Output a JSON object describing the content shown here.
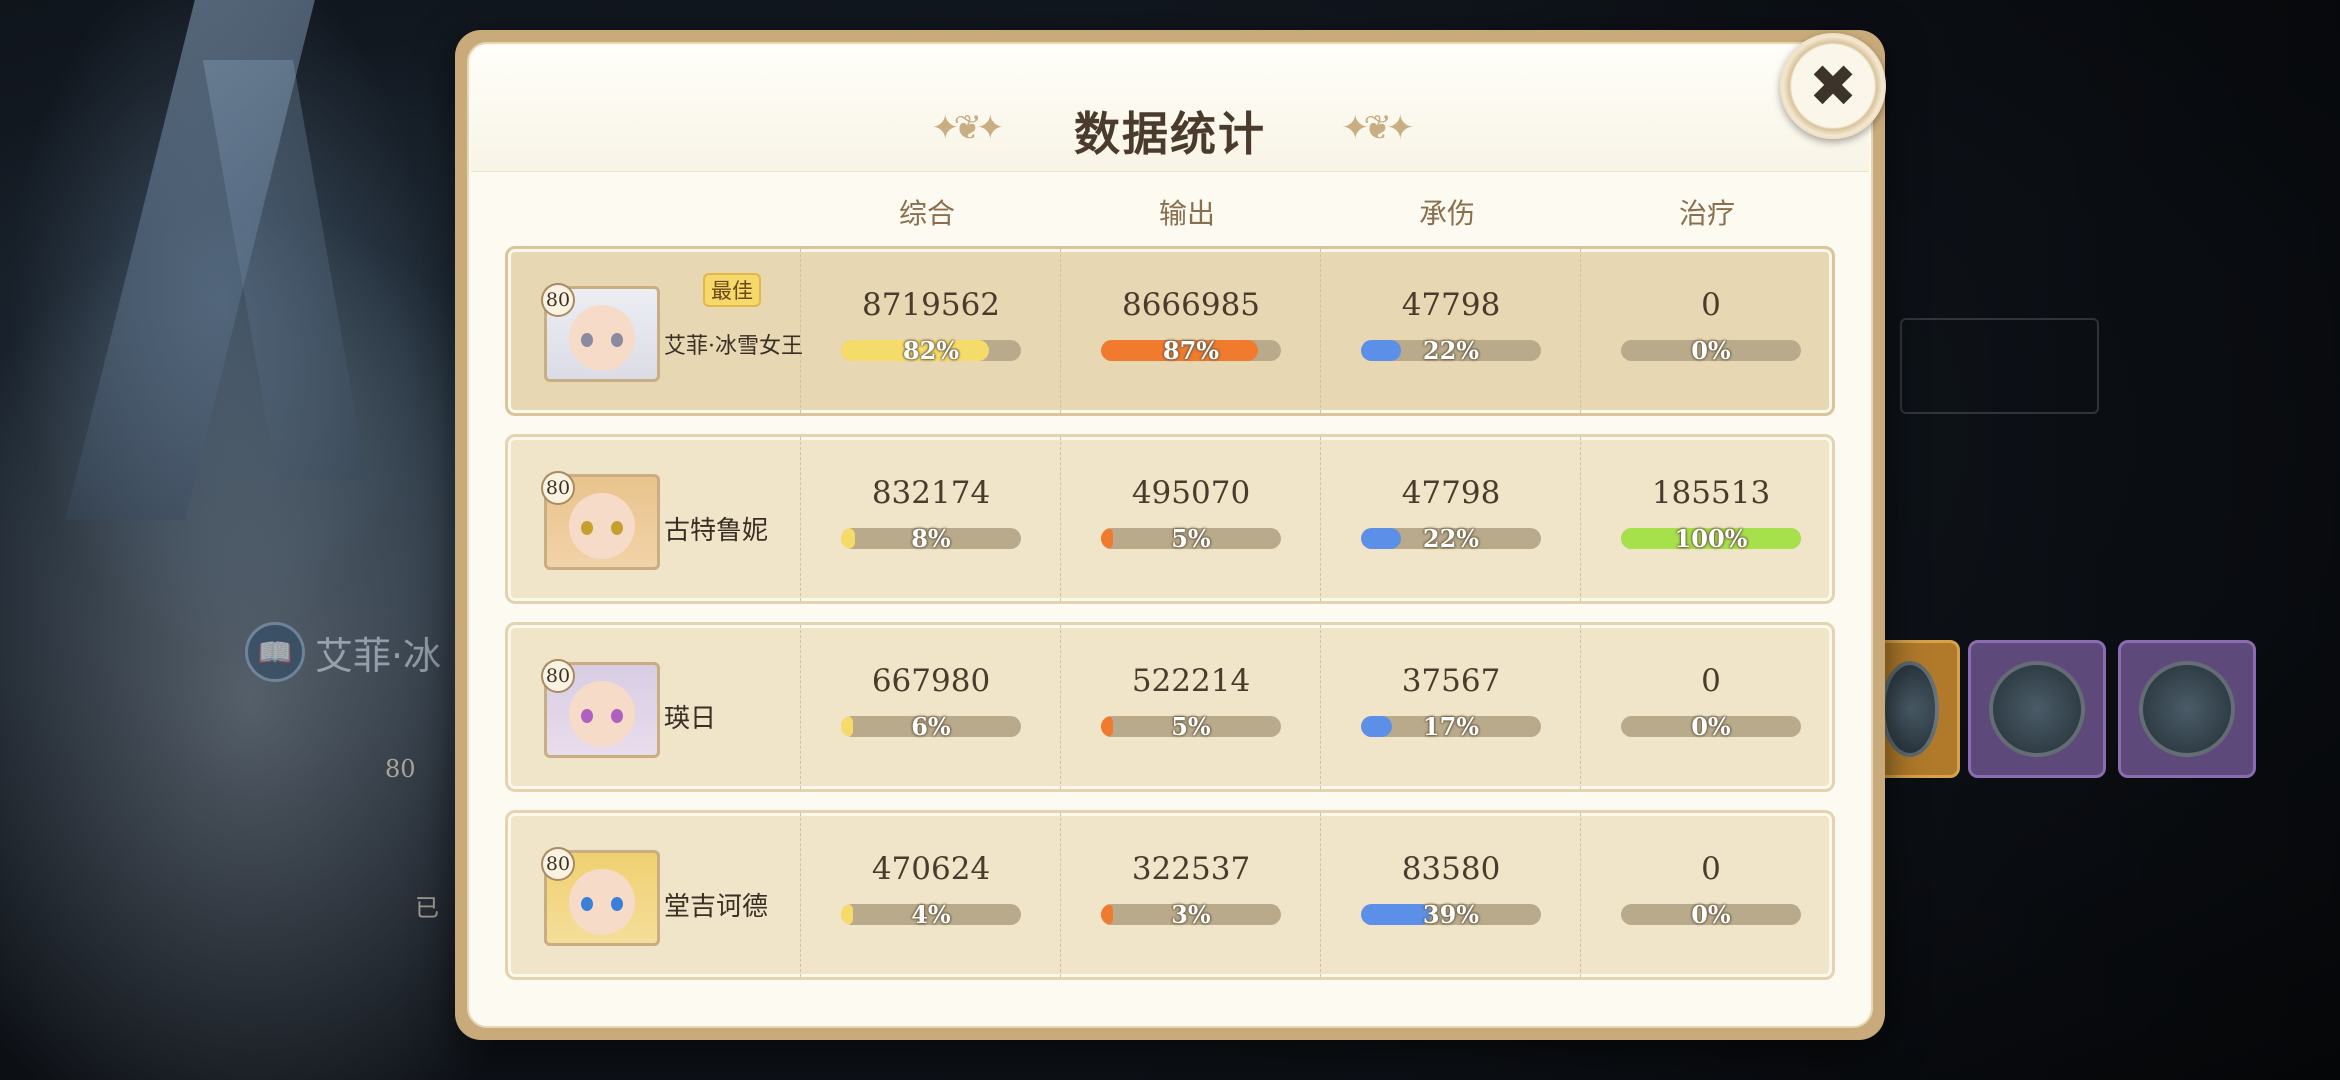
{
  "panel": {
    "title": "数据统计",
    "flourish_left": "✦❦✦",
    "flourish_right": "✦❦✦",
    "close_icon": "✖"
  },
  "columns": [
    "综合",
    "输出",
    "承伤",
    "治疗"
  ],
  "colors": {
    "overall": "#f5dc6a",
    "damage": "#f07a2e",
    "tank": "#5b8fe8",
    "heal": "#a6e04a"
  },
  "heroes": [
    {
      "level": "80",
      "name": "艾菲·冰雪女王",
      "badge": "最佳",
      "stats": [
        {
          "value": "8719562",
          "percent": "82%",
          "fraction": 0.82
        },
        {
          "value": "8666985",
          "percent": "87%",
          "fraction": 0.87
        },
        {
          "value": "47798",
          "percent": "22%",
          "fraction": 0.22
        },
        {
          "value": "0",
          "percent": "0%",
          "fraction": 0
        }
      ]
    },
    {
      "level": "80",
      "name": "古特鲁妮",
      "badge": "",
      "stats": [
        {
          "value": "832174",
          "percent": "8%",
          "fraction": 0.08
        },
        {
          "value": "495070",
          "percent": "5%",
          "fraction": 0.05
        },
        {
          "value": "47798",
          "percent": "22%",
          "fraction": 0.22
        },
        {
          "value": "185513",
          "percent": "100%",
          "fraction": 1.0
        }
      ]
    },
    {
      "level": "80",
      "name": "瑛日",
      "badge": "",
      "stats": [
        {
          "value": "667980",
          "percent": "6%",
          "fraction": 0.06
        },
        {
          "value": "522214",
          "percent": "5%",
          "fraction": 0.05
        },
        {
          "value": "37567",
          "percent": "17%",
          "fraction": 0.17
        },
        {
          "value": "0",
          "percent": "0%",
          "fraction": 0
        }
      ]
    },
    {
      "level": "80",
      "name": "堂吉诃德",
      "badge": "",
      "stats": [
        {
          "value": "470624",
          "percent": "4%",
          "fraction": 0.04
        },
        {
          "value": "322537",
          "percent": "3%",
          "fraction": 0.03
        },
        {
          "value": "83580",
          "percent": "39%",
          "fraction": 0.39
        },
        {
          "value": "0",
          "percent": "0%",
          "fraction": 0
        }
      ]
    }
  ],
  "background": {
    "hero_label": "艾菲·冰",
    "level": "80",
    "status": "已"
  }
}
